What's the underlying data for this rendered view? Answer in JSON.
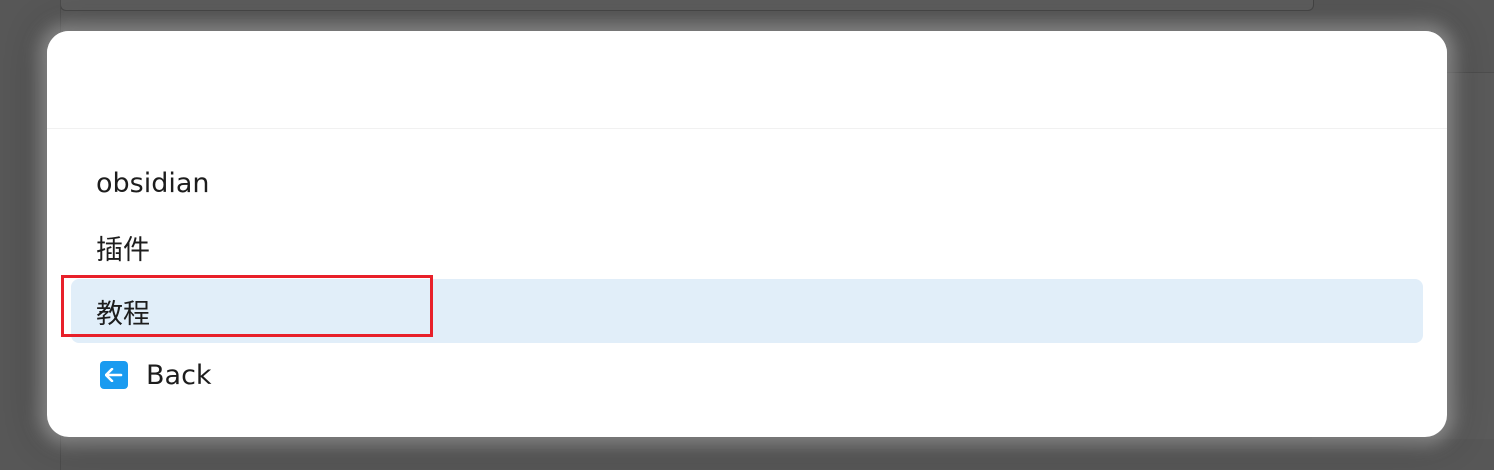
{
  "search": {
    "value": "",
    "placeholder": ""
  },
  "list": {
    "items": [
      {
        "label": "obsidian"
      },
      {
        "label": "插件"
      },
      {
        "label": "教程"
      }
    ],
    "back": {
      "label": "Back",
      "icon": "back-arrow-icon"
    }
  },
  "colors": {
    "selected_bg": "#e1eef9",
    "back_icon_bg": "#1a9bf0",
    "annotation": "#e8202a"
  }
}
